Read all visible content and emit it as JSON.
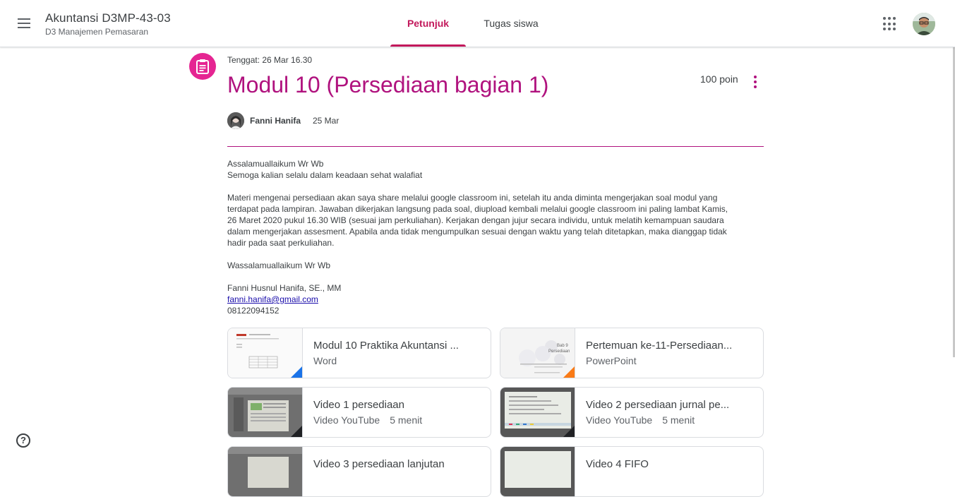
{
  "header": {
    "class_name": "Akuntansi D3MP-43-03",
    "class_section": "D3 Manajemen Pemasaran",
    "tabs": [
      {
        "label": "Petunjuk",
        "active": true
      },
      {
        "label": "Tugas siswa",
        "active": false
      }
    ]
  },
  "assignment": {
    "due": "Tenggat: 26 Mar 16.30",
    "title": "Modul 10 (Persediaan bagian 1)",
    "points": "100 poin",
    "author": "Fanni Hanifa",
    "date": "25 Mar",
    "accent_color": "#b0127e",
    "icon_color": "#e52592",
    "body": {
      "greeting1": "Assalamuallaikum Wr Wb",
      "greeting2": "Semoga kalian selalu dalam keadaan sehat walafiat",
      "para_lines": [
        "Materi mengenai persediaan akan saya share melalui google classroom ini, setelah itu anda diminta mengerjakan soal modul yang",
        "terdapat pada lampiran. Jawaban dikerjakan langsung pada soal, diupload kembali melalui google classroom ini paling lambat Kamis,",
        "26 Maret 2020 pukul 16.30 WIB (sesuai jam perkuliahan). Kerjakan dengan jujur secara individu, untuk melatih kemampuan saudara",
        "dalam mengerjakan assesment. Apabila anda tidak mengumpulkan sesuai dengan waktu yang telah ditetapkan, maka dianggap tidak",
        "hadir pada saat perkuliahan."
      ],
      "closing": "Wassalamuallaikum Wr Wb",
      "signature_name": "Fanni Husnul Hanifa, SE., MM",
      "email": "fanni.hanifa@gmail.com",
      "phone": "08122094152"
    }
  },
  "attachments": [
    {
      "title": "Modul 10 Praktika Akuntansi ...",
      "type": "Word",
      "duration": "",
      "icon": "word-file-icon",
      "corner_color": "#1a73e8"
    },
    {
      "title": "Pertemuan ke-11-Persediaan...",
      "type": "PowerPoint",
      "duration": "",
      "icon": "powerpoint-file-icon",
      "corner_color": "#fa7b17",
      "thumb_text": [
        "Bab 9",
        "Persediaan"
      ]
    },
    {
      "title": "Video 1 persediaan",
      "type": "Video YouTube",
      "duration": "5 menit",
      "icon": "youtube-video-icon",
      "corner_color": "#202124"
    },
    {
      "title": "Video 2 persediaan jurnal pe...",
      "type": "Video YouTube",
      "duration": "5 menit",
      "icon": "youtube-video-icon",
      "corner_color": "#202124"
    },
    {
      "title": "Video 3 persediaan lanjutan",
      "type": "",
      "duration": "",
      "icon": "youtube-video-icon",
      "corner_color": "#202124"
    },
    {
      "title": "Video 4 FIFO",
      "type": "",
      "duration": "",
      "icon": "youtube-video-icon",
      "corner_color": "#202124"
    }
  ]
}
